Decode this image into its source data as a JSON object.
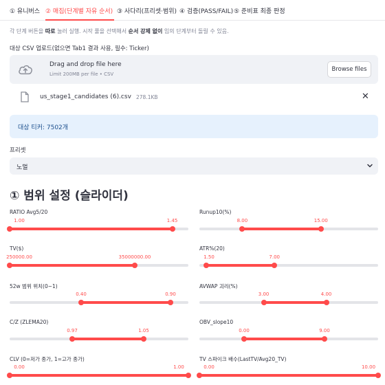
{
  "tabs": [
    {
      "label": "① 유니버스"
    },
    {
      "label": "② 매집(단계별 자유 순서)"
    },
    {
      "label": "③ 사다리(프리셋·범위)"
    },
    {
      "label": "④ 검증(PASS/FAIL)"
    },
    {
      "label": "⑤ 준비표 최종 판정"
    }
  ],
  "hint": {
    "part1": "각 단계 버튼을 ",
    "bold1": "따로",
    "part2": " 눌러 실행. 시작 풀을 선택해서 ",
    "bold2": "순서 강제 없이",
    "part3": " 임의 단계부터 돌릴 수 있음."
  },
  "upload": {
    "label": "대상 CSV 업로드(없으면 Tab1 결과 사용, 필수: Ticker)",
    "drop_title": "Drag and drop file here",
    "drop_sub": "Limit 200MB per file • CSV",
    "browse_label": "Browse files"
  },
  "file": {
    "name": "us_stage1_candidates (6).csv",
    "size": "278.1KB"
  },
  "info": {
    "text": "대상 티커: 7502개"
  },
  "preset": {
    "label": "프리셋",
    "value": "노멀"
  },
  "section_title": "① 범위 설정 (슬라이더)",
  "colors": {
    "accent": "#ff4b4b",
    "info_bg": "#e6f1fd",
    "input_bg": "#f0f2f6"
  },
  "icons": {
    "upload": "cloud-upload-icon",
    "file": "file-icon",
    "close": "close-icon",
    "select": "chevron-down-icon"
  },
  "sliders": [
    {
      "label": "RATIO Avg5/20",
      "low": "1.00",
      "high": "1.45",
      "low_frac": 0.0,
      "high_frac": 0.91
    },
    {
      "label": "Runup10(%)",
      "low": "8.00",
      "high": "15.00",
      "low_frac": 0.24,
      "high_frac": 0.68
    },
    {
      "label": "TV($)",
      "low": "250000.00",
      "high": "35000000.00",
      "low_frac": 0.0,
      "high_frac": 0.7
    },
    {
      "label": "ATR%(20)",
      "low": "1.50",
      "high": "7.00",
      "low_frac": 0.04,
      "high_frac": 0.42
    },
    {
      "label": "52w 범위 위치(0~1)",
      "low": "0.40",
      "high": "0.90",
      "low_frac": 0.4,
      "high_frac": 0.9
    },
    {
      "label": "AVWAP 괴리(%)",
      "low": "3.00",
      "high": "4.00",
      "low_frac": 0.36,
      "high_frac": 0.71
    },
    {
      "label": "C/Z (ZLEMA20)",
      "low": "0.97",
      "high": "1.05",
      "low_frac": 0.35,
      "high_frac": 0.75
    },
    {
      "label": "OBV_slope10",
      "low": "0.00",
      "high": "9.00",
      "low_frac": 0.25,
      "high_frac": 0.7
    },
    {
      "label": "CLV (0=저가 종가, 1=고가 종가)",
      "low": "0.00",
      "high": "1.00",
      "low_frac": 0.0,
      "high_frac": 1.0
    },
    {
      "label": "TV 스파이크 배수(LastTV/Avg20_TV)",
      "low": "0.00",
      "high": "10.00",
      "low_frac": 0.0,
      "high_frac": 1.0
    }
  ]
}
